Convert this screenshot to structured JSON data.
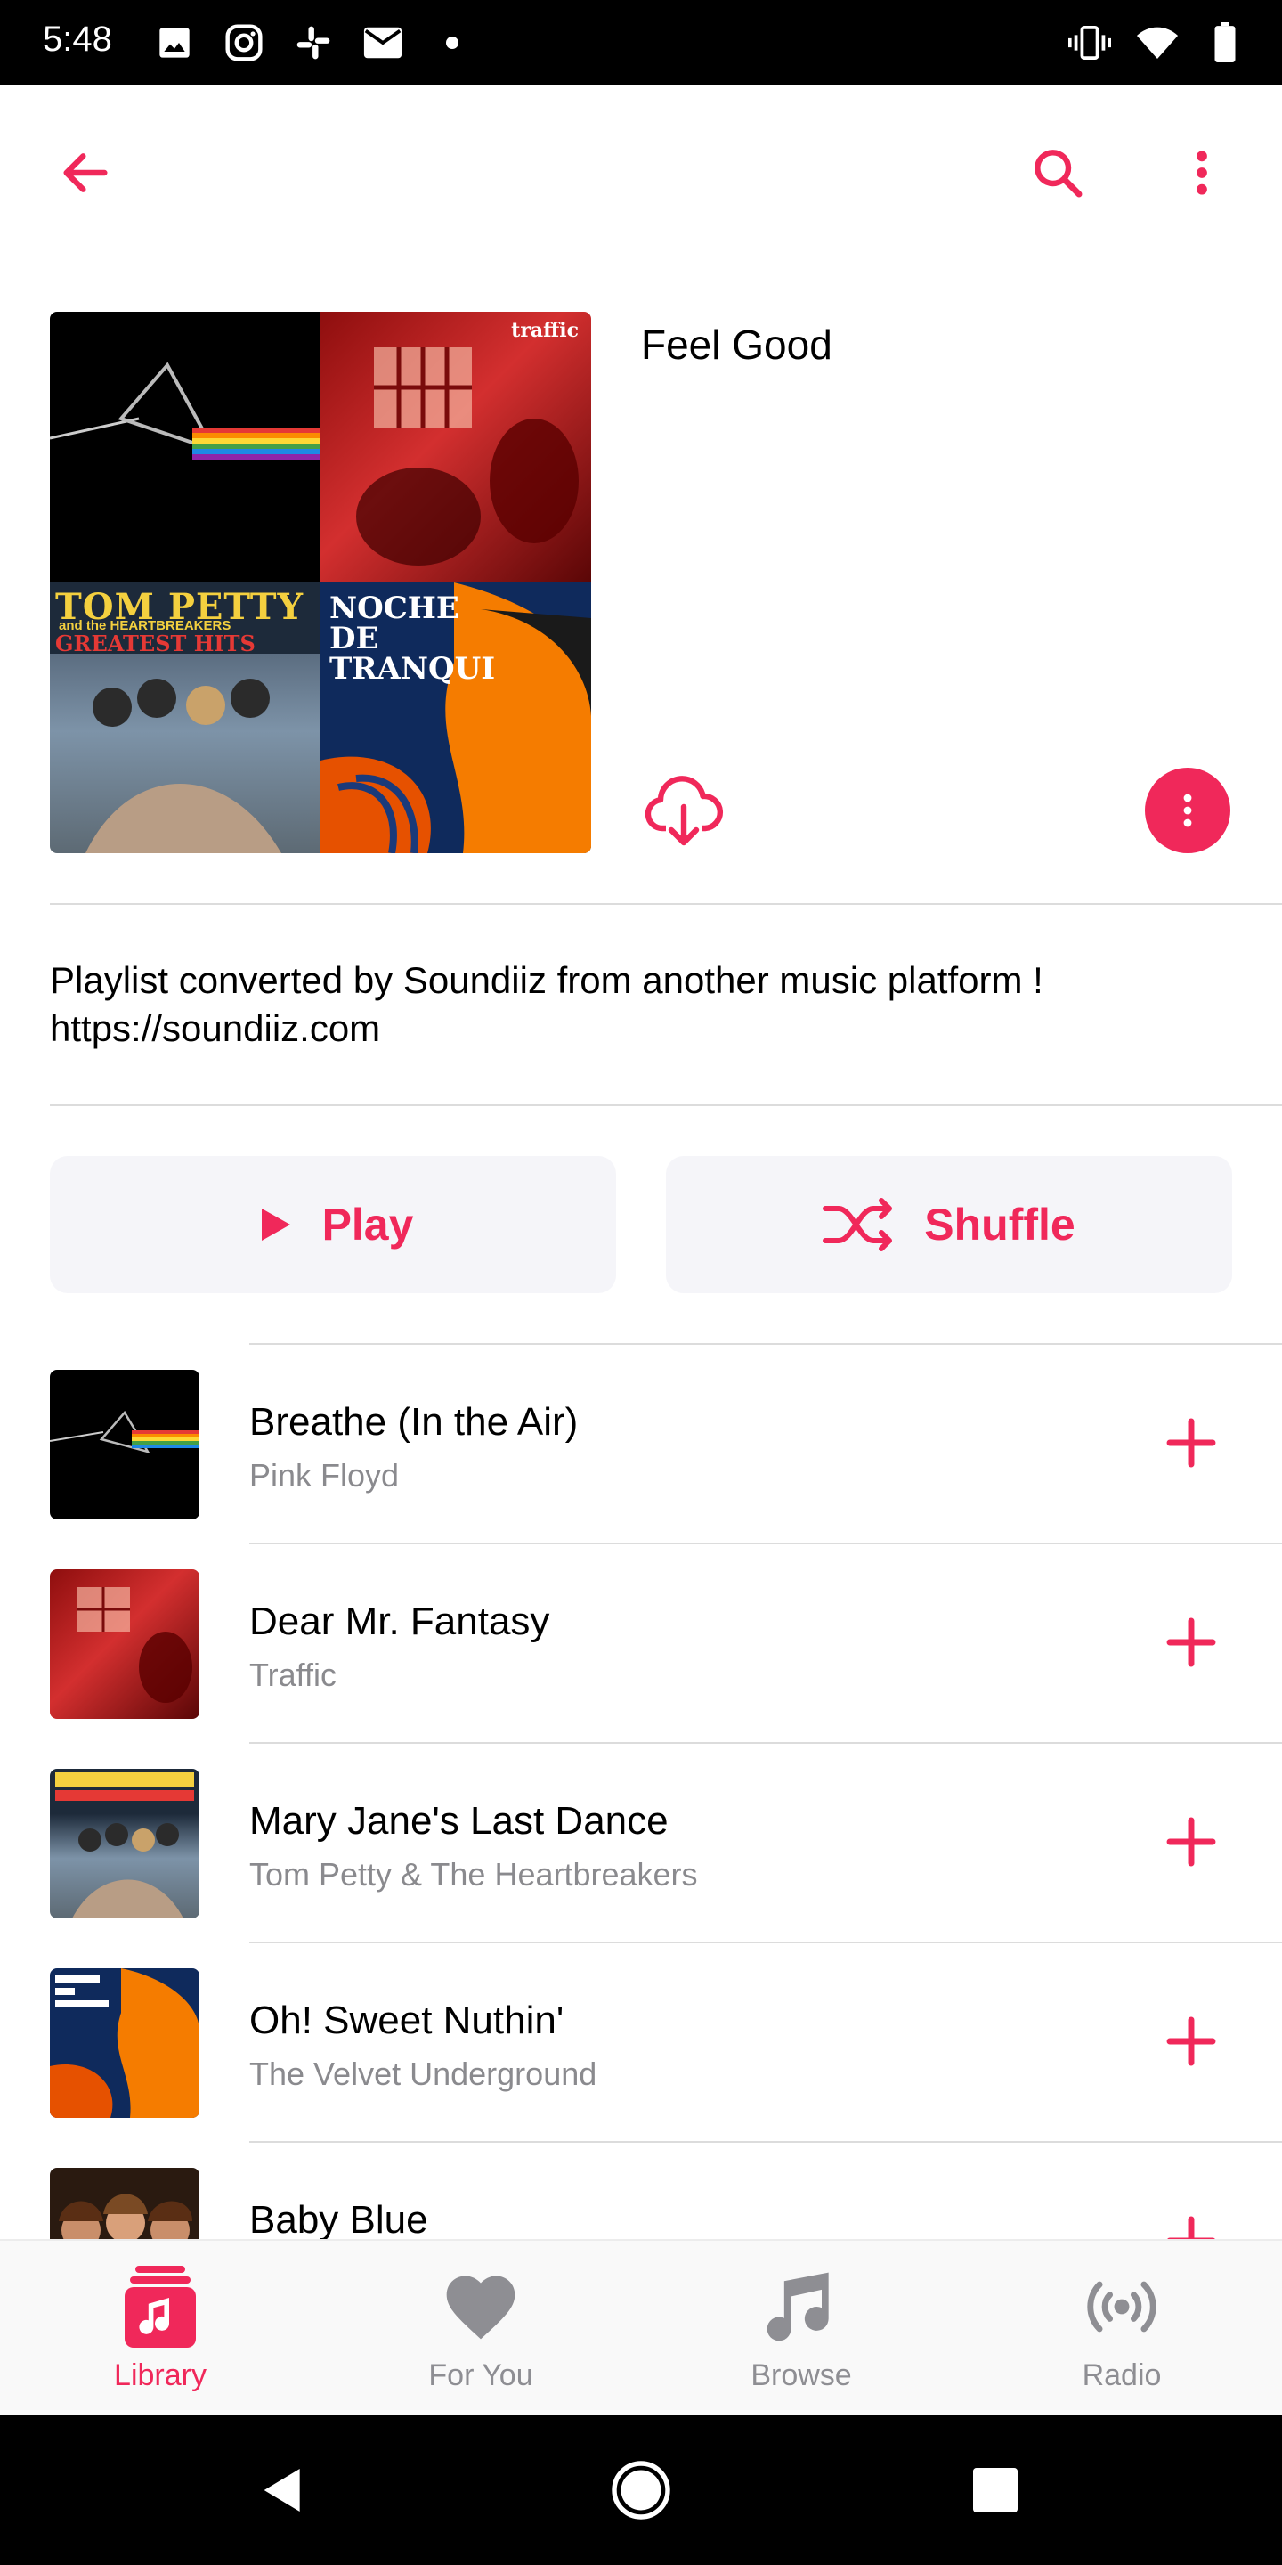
{
  "status_bar": {
    "time": "5:48",
    "left_icons": [
      "image-icon",
      "instagram-icon",
      "slack-icon",
      "mail-icon",
      "dot-icon"
    ],
    "right_icons": [
      "vibrate-icon",
      "wifi-icon",
      "battery-icon"
    ]
  },
  "app_bar": {
    "icons": [
      "back-arrow-icon",
      "search-icon",
      "more-vertical-icon"
    ]
  },
  "colors": {
    "accent": "#f0285a",
    "secondary_text": "#8a8a8e",
    "button_bg": "#f5f5f9"
  },
  "playlist": {
    "title": "Feel Good",
    "description_line1": "Playlist converted by Soundiiz from another music platform !",
    "description_line2": "https://soundiiz.com",
    "artwork_texts": {
      "traffic_badge": "traffic",
      "tom_petty": "TOM PETTY",
      "heartbreakers": "and the HEARTBREAKERS",
      "greatest_hits": "GREATEST HITS",
      "noche1": "NOCHE",
      "noche2": "DE",
      "noche3": "TRANQUI"
    }
  },
  "actions": {
    "play_label": "Play",
    "shuffle_label": "Shuffle"
  },
  "tracks": [
    {
      "title": "Breathe (In the Air)",
      "artist": "Pink Floyd"
    },
    {
      "title": "Dear Mr. Fantasy",
      "artist": "Traffic"
    },
    {
      "title": "Mary Jane's Last Dance",
      "artist": "Tom Petty & The Heartbreakers"
    },
    {
      "title": "Oh! Sweet Nuthin'",
      "artist": "The Velvet Underground"
    },
    {
      "title": "Baby Blue",
      "artist": ""
    }
  ],
  "tabs": [
    {
      "label": "Library",
      "icon": "library-icon",
      "active": true
    },
    {
      "label": "For You",
      "icon": "heart-icon",
      "active": false
    },
    {
      "label": "Browse",
      "icon": "music-note-icon",
      "active": false
    },
    {
      "label": "Radio",
      "icon": "radio-icon",
      "active": false
    }
  ]
}
